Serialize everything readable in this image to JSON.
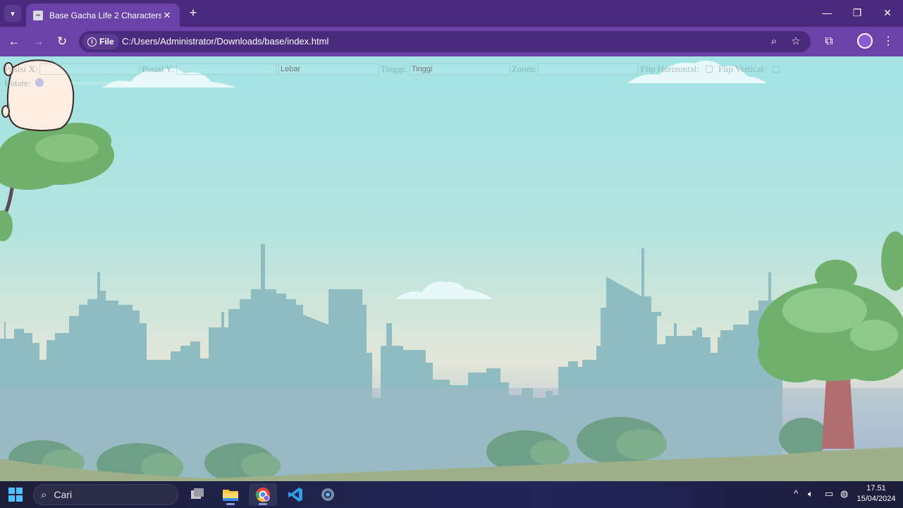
{
  "browser": {
    "tab": {
      "title": "Base Gacha Life 2 Characters",
      "favicon": "page-favicon-icon"
    },
    "site_chip_label": "File",
    "url": "C:/Users/Administrator/Downloads/base/index.html"
  },
  "controls": {
    "posisi_x_label": "Posisi X:",
    "posisi_y_label": "Posisi Y:",
    "lebar_placeholder": "Lebar",
    "tinggi_label": "Tinggi:",
    "tinggi_placeholder": "Tinggi",
    "zoom_label": "Zoom:",
    "flip_h_label": "Flip Horizontal:",
    "flip_v_label": "Flip Vertical:",
    "rotate_label": "Rotate:",
    "rotate_value": "0"
  },
  "taskbar": {
    "search_label": "Cari",
    "apps": [
      "task-view-icon",
      "file-explorer-icon",
      "chrome-icon",
      "vscode-icon",
      "settings-icon"
    ],
    "time": "17.51",
    "date": "15/04/2024"
  },
  "colors": {
    "chrome_dark": "#4a2a7c",
    "chrome_light": "#6a42a8",
    "sky_top": "#a4e4e4",
    "city": "#8fbcc0",
    "grass": "#9db08a"
  }
}
